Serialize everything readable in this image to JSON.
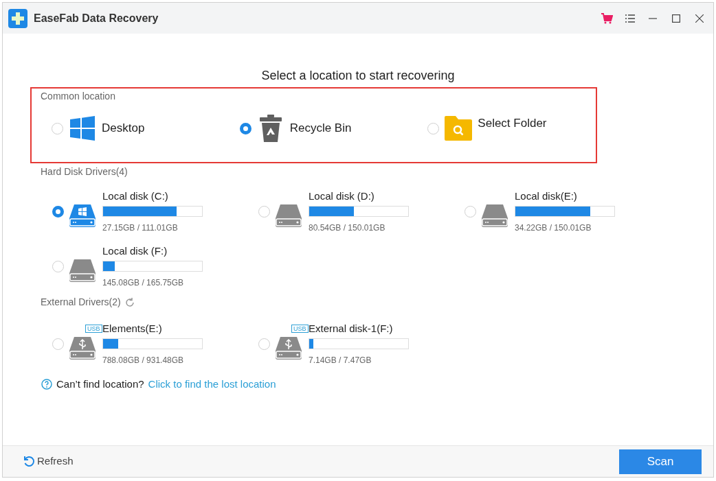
{
  "window": {
    "title": "EaseFab Data Recovery"
  },
  "heading": "Select a location to start recovering",
  "common_location": {
    "label": "Common location",
    "items": [
      {
        "label": "Desktop",
        "kind": "desktop",
        "selected": false
      },
      {
        "label": "Recycle Bin",
        "kind": "recycle",
        "selected": true
      },
      {
        "label": "Select Folder",
        "kind": "folder",
        "selected": false
      }
    ]
  },
  "hard_disks": {
    "label": "Hard Disk Drivers(4)",
    "drives": [
      {
        "name": "Local disk (C:)",
        "kind": "system",
        "selected": true,
        "level": 0.74,
        "usage": "27.15GB / 111.01GB"
      },
      {
        "name": "Local disk (D:)",
        "kind": "disk",
        "selected": false,
        "level": 0.45,
        "usage": "80.54GB / 150.01GB"
      },
      {
        "name": "Local disk(E:)",
        "kind": "disk",
        "selected": false,
        "level": 0.76,
        "usage": "34.22GB / 150.01GB"
      },
      {
        "name": "Local disk (F:)",
        "kind": "disk",
        "selected": false,
        "level": 0.12,
        "usage": "145.08GB / 165.75GB"
      }
    ]
  },
  "external_drives": {
    "label": "External Drivers(2)",
    "drives": [
      {
        "name": "Elements(E:)",
        "kind": "usb",
        "badge": "USB",
        "selected": false,
        "level": 0.15,
        "usage": "788.08GB / 931.48GB"
      },
      {
        "name": "External disk-1(F:)",
        "kind": "usb",
        "badge": "USB",
        "selected": false,
        "level": 0.04,
        "usage": "7.14GB / 7.47GB"
      }
    ]
  },
  "help": {
    "question": "Can’t find location?",
    "link": "Click to find the lost location"
  },
  "footer": {
    "refresh": "Refresh",
    "scan": "Scan"
  }
}
